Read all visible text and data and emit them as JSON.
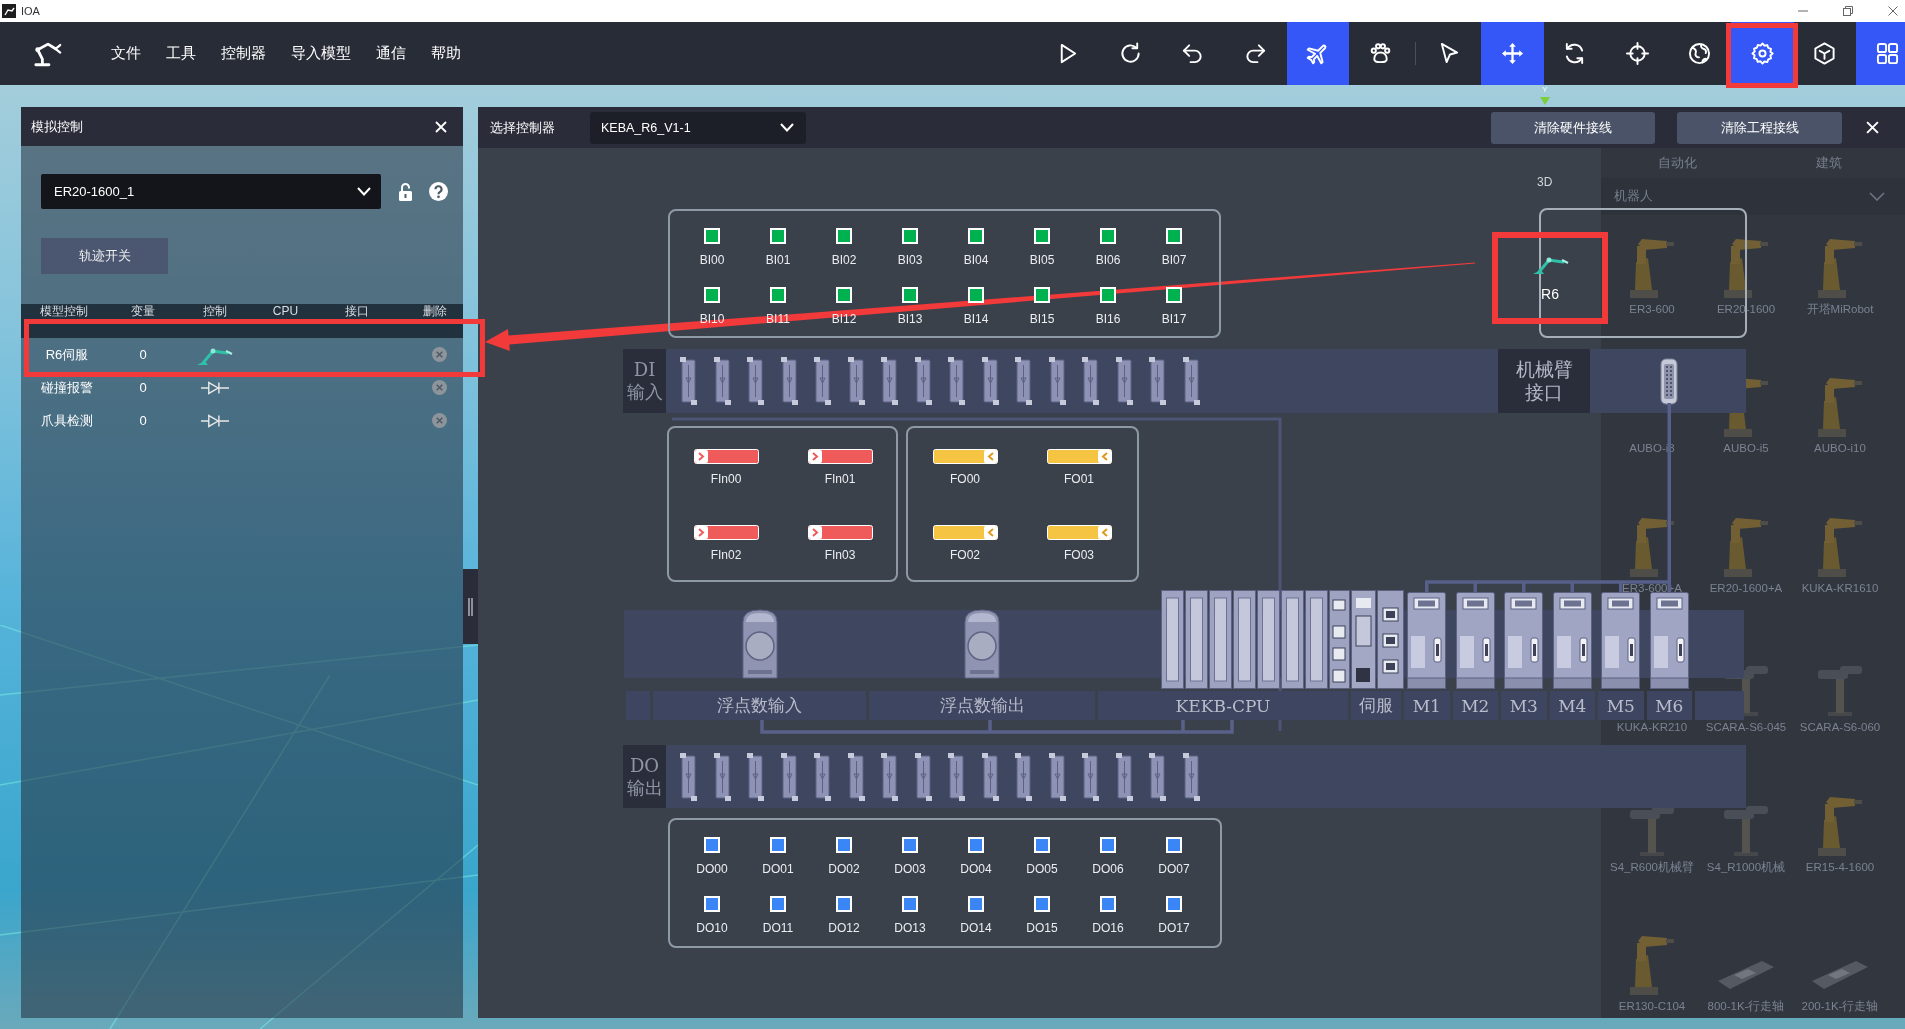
{
  "window": {
    "title": "IOA"
  },
  "menu": [
    {
      "label": "文件"
    },
    {
      "label": "工具"
    },
    {
      "label": "控制器"
    },
    {
      "label": "导入模型"
    },
    {
      "label": "通信"
    },
    {
      "label": "帮助"
    }
  ],
  "toolbar": [
    [
      {
        "kind": "play",
        "selected": false,
        "annotated": false
      },
      {
        "kind": "reload",
        "selected": false,
        "annotated": false
      },
      {
        "kind": "undo",
        "selected": false,
        "annotated": false
      },
      {
        "kind": "redo",
        "selected": false,
        "annotated": false
      },
      {
        "kind": "airplane",
        "selected": true,
        "annotated": false
      },
      {
        "kind": "paw",
        "selected": false,
        "annotated": false
      }
    ],
    [
      {
        "kind": "cursor",
        "selected": false,
        "annotated": false
      },
      {
        "kind": "move",
        "selected": true,
        "annotated": false
      },
      {
        "kind": "rotate",
        "selected": false,
        "annotated": false
      },
      {
        "kind": "crosshair",
        "selected": false,
        "annotated": false
      },
      {
        "kind": "globe",
        "selected": false,
        "annotated": false
      },
      {
        "kind": "gear",
        "selected": true,
        "annotated": true
      },
      {
        "kind": "cube",
        "selected": false,
        "annotated": false
      },
      {
        "kind": "grid",
        "selected": true,
        "annotated": false
      }
    ]
  ],
  "scene": {
    "axis_label": "Y"
  },
  "sim_panel": {
    "title": "模拟控制",
    "model_select": {
      "value": "ER20-1600_1"
    },
    "locked": false,
    "trace_button": "轨迹开关",
    "columns": [
      "模型控制",
      "变量",
      "控制",
      "CPU",
      "接口",
      "删除"
    ],
    "rows": [
      {
        "name": "R6伺服",
        "variable": "0",
        "kind": "servo",
        "annotated": true
      },
      {
        "name": "碰撞报警",
        "variable": "0",
        "kind": "switch",
        "annotated": false
      },
      {
        "name": "爪具检测",
        "variable": "0",
        "kind": "switch",
        "annotated": false
      }
    ]
  },
  "controller_panel": {
    "label": "选择控制器",
    "controller_select": {
      "value": "KEBA_R6_V1-1"
    },
    "buttons": [
      {
        "label": "清除硬件接线"
      },
      {
        "label": "清除工程接线"
      }
    ],
    "view_label": "3D",
    "robot": {
      "label": "R6",
      "annotated": true
    },
    "digital_inputs": [
      "BI00",
      "BI01",
      "BI02",
      "BI03",
      "BI04",
      "BI05",
      "BI06",
      "BI07",
      "BI10",
      "BI11",
      "BI12",
      "BI13",
      "BI14",
      "BI15",
      "BI16",
      "BI17"
    ],
    "di_label": "DI 输入",
    "arm_interface": "机械臂接口",
    "float_inputs": [
      "FIn00",
      "FIn01",
      "FIn02",
      "FIn03"
    ],
    "float_outputs": [
      "FO00",
      "FO01",
      "FO02",
      "FO03"
    ],
    "slots": [
      {
        "label": "浮点数输入",
        "kind": "analog_in"
      },
      {
        "label": "浮点数输出",
        "kind": "analog_out"
      },
      {
        "label": "KEKB-CPU",
        "kind": "cpu"
      },
      {
        "label": "伺服",
        "kind": "caption"
      },
      {
        "label": "M1",
        "kind": "drive"
      },
      {
        "label": "M2",
        "kind": "drive"
      },
      {
        "label": "M3",
        "kind": "drive"
      },
      {
        "label": "M4",
        "kind": "drive"
      },
      {
        "label": "M5",
        "kind": "drive"
      },
      {
        "label": "M6",
        "kind": "drive"
      }
    ],
    "do_label": "DO 输出",
    "digital_outputs": [
      "DO00",
      "DO01",
      "DO02",
      "DO03",
      "DO04",
      "DO05",
      "DO06",
      "DO07",
      "DO10",
      "DO11",
      "DO12",
      "DO13",
      "DO14",
      "DO15",
      "DO16",
      "DO17"
    ]
  },
  "library": {
    "tabs": [
      "自动化",
      "建筑"
    ],
    "category": "机器人",
    "items": [
      {
        "label": "ER3-600",
        "kind": "arm"
      },
      {
        "label": "ER20-1600",
        "kind": "arm"
      },
      {
        "label": "开塔MiRobot",
        "kind": "arm"
      },
      {
        "label": "AUBO-i3"
      },
      {
        "label": "AUBO-i5",
        "kind": "arm"
      },
      {
        "label": "AUBO-i10",
        "kind": "arm"
      },
      {
        "label": "ER3-600+A",
        "kind": "arm"
      },
      {
        "label": "ER20-1600+A",
        "kind": "arm"
      },
      {
        "label": "KUKA-KR1610",
        "kind": "arm"
      },
      {
        "label": "KUKA-KR210"
      },
      {
        "label": "SCARA-S6-045",
        "kind": "scara"
      },
      {
        "label": "SCARA-S6-060",
        "kind": "scara"
      },
      {
        "label": "S4_R600机械臂",
        "kind": "scara"
      },
      {
        "label": "S4_R1000机械",
        "kind": "scara"
      },
      {
        "label": "ER15-4-1600",
        "kind": "arm"
      },
      {
        "label": "ER130-C104",
        "kind": "arm"
      },
      {
        "label": "800-1K-行走轴",
        "kind": "track"
      },
      {
        "label": "200-1K-行走轴",
        "kind": "track"
      }
    ]
  }
}
